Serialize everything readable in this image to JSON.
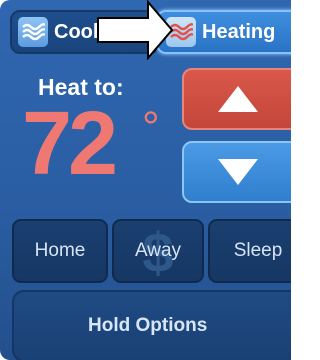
{
  "modes": {
    "cool": {
      "label": "Cool",
      "icon": "cool-waves-icon",
      "selected": false
    },
    "heat": {
      "label": "Heating",
      "icon": "heat-waves-icon",
      "selected": true
    }
  },
  "setpoint": {
    "label": "Heat to:",
    "value": "72",
    "unit_symbol": "°"
  },
  "controls": {
    "up_icon": "up-triangle-icon",
    "down_icon": "down-triangle-icon"
  },
  "presets": [
    {
      "label": "Home"
    },
    {
      "label": "Away",
      "icon": "dollar-icon",
      "icon_glyph": "$"
    },
    {
      "label": "Sleep"
    }
  ],
  "hold": {
    "label": "Hold Options"
  },
  "colors": {
    "background": "#2a5ea3",
    "temperature": "#f07872",
    "up_button": "#d9584a",
    "down_button": "#3f8fde",
    "selected_tab_border": "#86c2ff"
  }
}
